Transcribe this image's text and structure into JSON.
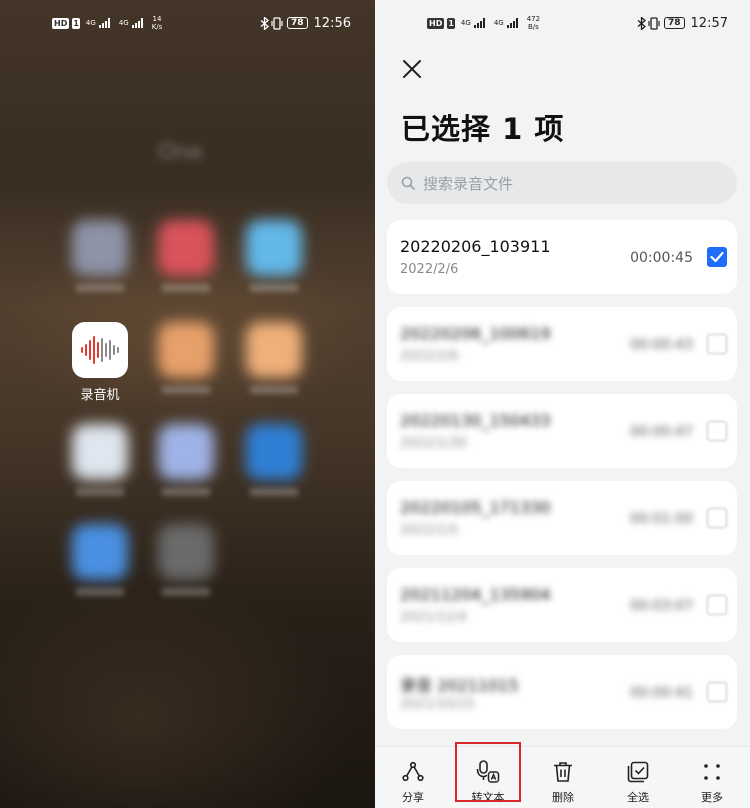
{
  "left_screen": {
    "status_bar": {
      "hd_badge": "HD",
      "sim": "1",
      "net1": "4G",
      "net2": "4G",
      "speed_value": "14",
      "speed_unit": "K/s",
      "battery": "78",
      "time": "12:56"
    },
    "folder_title": "One",
    "apps": [
      {
        "label": "录音机",
        "icon": "voice-recorder-icon"
      }
    ],
    "blurred_icon_colors": [
      "#8e93a8",
      "#d9535b",
      "#63b8ea",
      "#e8a06a",
      "#f0b07a",
      "#dfe6ef",
      "#9fb3e6",
      "#2f7fd6",
      "#4a90e2",
      "#6a6a6a"
    ]
  },
  "right_screen": {
    "status_bar": {
      "hd_badge": "HD",
      "sim": "1",
      "net1": "4G",
      "net2": "4G",
      "speed_value": "472",
      "speed_unit": "B/s",
      "battery": "78",
      "time": "12:57"
    },
    "title": "已选择 1 项",
    "search": {
      "placeholder": "搜索录音文件",
      "icon": "search-icon"
    },
    "recordings": [
      {
        "name": "20220206_103911",
        "date": "2022/2/6",
        "duration": "00:00:45",
        "checked": true
      },
      {
        "name": "20220206_100619",
        "date": "2022/2/6",
        "duration": "00:00:43",
        "checked": false
      },
      {
        "name": "20220130_150433",
        "date": "2022/1/30",
        "duration": "00:00:47",
        "checked": false
      },
      {
        "name": "20220105_171330",
        "date": "2022/1/5",
        "duration": "00:01:00",
        "checked": false
      },
      {
        "name": "20211204_135904",
        "date": "2021/12/4",
        "duration": "00:03:07",
        "checked": false
      },
      {
        "name": "录音 20211015",
        "date": "2021/10/15",
        "duration": "00:00:41",
        "checked": false
      }
    ],
    "toolbar": [
      {
        "label": "分享",
        "icon": "share-icon"
      },
      {
        "label": "转文本",
        "icon": "speech-to-text-icon"
      },
      {
        "label": "删除",
        "icon": "trash-icon"
      },
      {
        "label": "全选",
        "icon": "select-all-icon"
      },
      {
        "label": "更多",
        "icon": "more-icon"
      }
    ],
    "accent_color": "#1f6ef7",
    "highlight_color": "#d42a2a"
  }
}
